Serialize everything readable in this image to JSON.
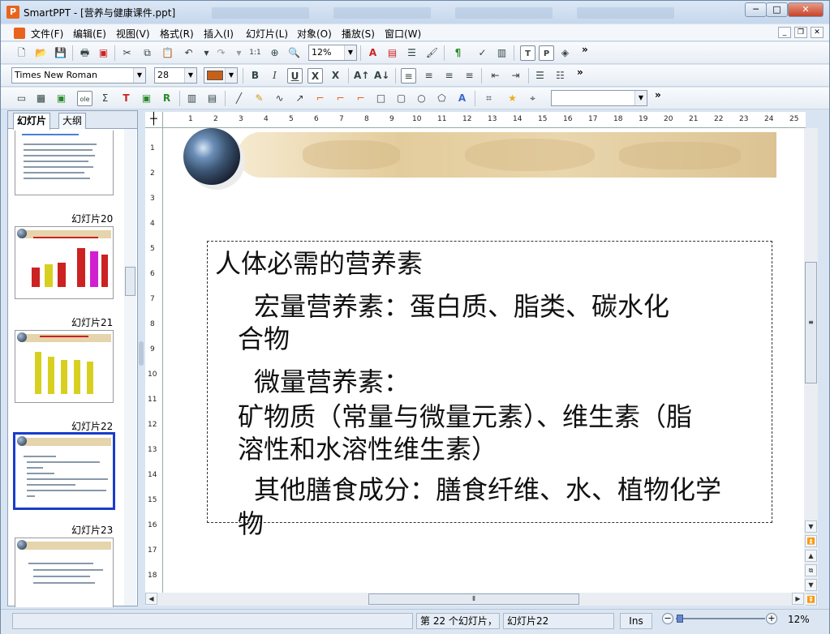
{
  "window": {
    "title": "SmartPPT - [营养与健康课件.ppt]",
    "app_icon_letter": "P",
    "minimize": "─",
    "maximize": "□",
    "close": "✕"
  },
  "menu": [
    "文件(F)",
    "编辑(E)",
    "视图(V)",
    "格式(R)",
    "插入(I)",
    "幻灯片(L)",
    "对象(O)",
    "播放(S)",
    "窗口(W)"
  ],
  "mdi": {
    "minimize": "_",
    "restore": "❐",
    "close": "✕"
  },
  "toolbar": {
    "zoom": "12%",
    "font": "Times New Roman",
    "size": "28",
    "more": "»",
    "object_combo": ""
  },
  "tabs": {
    "slides": "幻灯片",
    "outline": "大纲"
  },
  "thumbnails": [
    {
      "label": "幻灯片20"
    },
    {
      "label": "幻灯片21"
    },
    {
      "label": "幻灯片22"
    },
    {
      "label": "幻灯片23"
    }
  ],
  "ruler": {
    "h": [
      "1",
      "2",
      "3",
      "4",
      "5",
      "6",
      "7",
      "8",
      "9",
      "10",
      "11",
      "12",
      "13",
      "14",
      "15",
      "16",
      "17",
      "18",
      "19",
      "20",
      "21",
      "22",
      "23",
      "24",
      "25"
    ],
    "v": [
      "1",
      "2",
      "3",
      "4",
      "5",
      "6",
      "7",
      "8",
      "9",
      "10",
      "11",
      "12",
      "13",
      "14",
      "15",
      "16",
      "17",
      "18"
    ]
  },
  "slide": {
    "lines": [
      "人体必需的营养素",
      "宏量营养素：蛋白质、脂类、碳水化",
      "合物",
      "微量营养素：",
      "矿物质（常量与微量元素）、维生素（脂",
      "溶性和水溶性维生素）",
      "其他膳食成分：膳食纤维、水、植物化学",
      "物"
    ]
  },
  "status": {
    "count": "第 22 个幻灯片，",
    "current": "幻灯片22",
    "mode": "Ins",
    "zoom": "12%",
    "zoom_minus": "−",
    "zoom_plus": "+"
  },
  "colors": {
    "accent": "#1a3ccc",
    "fill_color": "#c8601a",
    "banner": "#e3cc9c"
  }
}
